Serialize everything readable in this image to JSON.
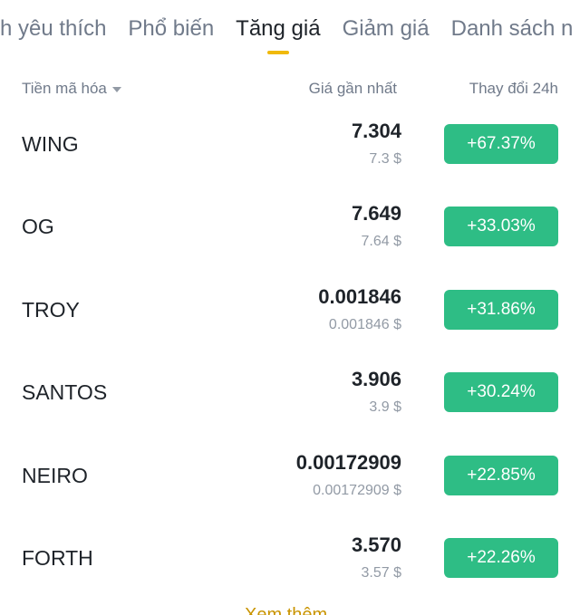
{
  "tabs": [
    {
      "label": "ch yêu thích"
    },
    {
      "label": "Phổ biến"
    },
    {
      "label": "Tăng giá"
    },
    {
      "label": "Giảm giá"
    },
    {
      "label": "Danh sách n"
    }
  ],
  "active_tab": "Tăng giá",
  "header": {
    "coin": "Tiền mã hóa",
    "price": "Giá gần nhất",
    "change": "Thay đổi 24h"
  },
  "rows": [
    {
      "coin": "WING",
      "price": "7.304",
      "usd": "7.3 $",
      "change": "+67.37%"
    },
    {
      "coin": "OG",
      "price": "7.649",
      "usd": "7.64 $",
      "change": "+33.03%"
    },
    {
      "coin": "TROY",
      "price": "0.001846",
      "usd": "0.001846 $",
      "change": "+31.86%"
    },
    {
      "coin": "SANTOS",
      "price": "3.906",
      "usd": "3.9 $",
      "change": "+30.24%"
    },
    {
      "coin": "NEIRO",
      "price": "0.00172909",
      "usd": "0.00172909 $",
      "change": "+22.85%"
    },
    {
      "coin": "FORTH",
      "price": "3.570",
      "usd": "3.57 $",
      "change": "+22.26%"
    }
  ],
  "more_label": "Xem thêm",
  "colors": {
    "accent": "#f0b90b",
    "positive": "#2ebd85"
  }
}
